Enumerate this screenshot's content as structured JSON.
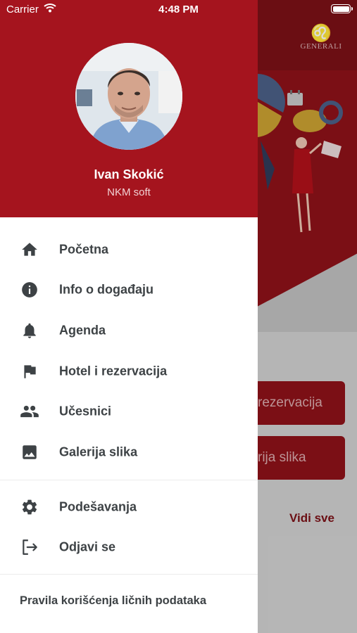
{
  "status_bar": {
    "carrier": "Carrier",
    "time": "4:48 PM"
  },
  "background": {
    "logo_text": "GENERALI",
    "buttons": [
      "rezervacija",
      "rija slika"
    ],
    "link": "Vidi sve"
  },
  "drawer": {
    "user_name": "Ivan Skokić",
    "user_org": "NKM soft",
    "menu_items": [
      {
        "label": "Početna",
        "icon": "home-icon"
      },
      {
        "label": "Info o događaju",
        "icon": "info-icon"
      },
      {
        "label": "Agenda",
        "icon": "bell-icon"
      },
      {
        "label": "Hotel i rezervacija",
        "icon": "flag-icon"
      },
      {
        "label": "Učesnici",
        "icon": "people-icon"
      },
      {
        "label": "Galerija slika",
        "icon": "image-icon"
      }
    ],
    "secondary_items": [
      {
        "label": "Podešavanja",
        "icon": "gear-icon"
      },
      {
        "label": "Odjavi se",
        "icon": "logout-icon"
      }
    ],
    "privacy_link": "Pravila korišćenja ličnih podataka"
  },
  "colors": {
    "brand_red": "#a5141e",
    "text_dark": "#3d4245"
  }
}
